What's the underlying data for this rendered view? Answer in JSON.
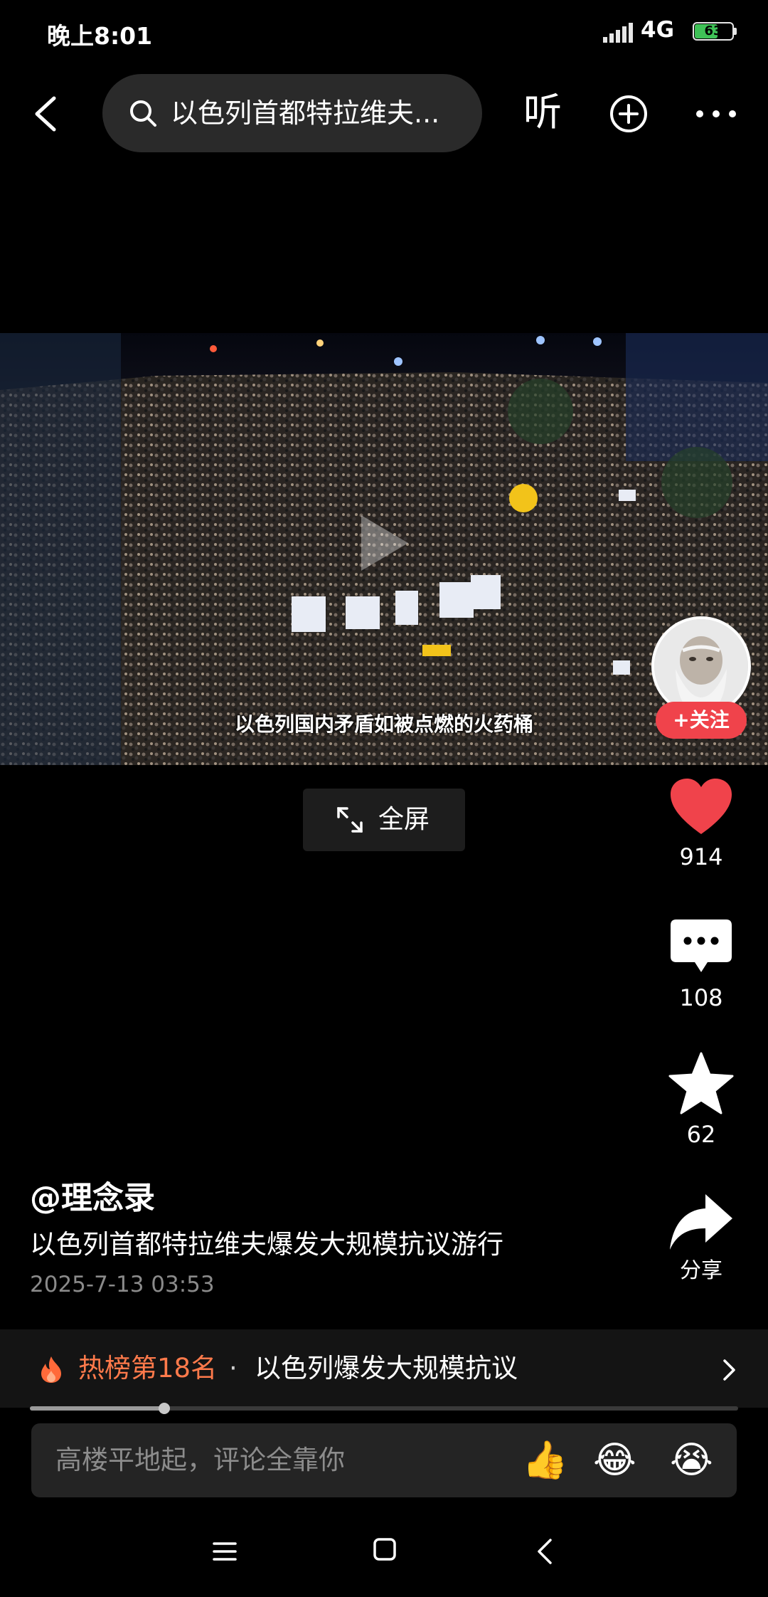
{
  "status_bar": {
    "time": "晚上8:01",
    "network": "4G",
    "battery": "63",
    "battery_level": 0.63
  },
  "top_nav": {
    "search_text": "以色列首都特拉维夫...",
    "listen_label": "听"
  },
  "video": {
    "subtitle": "以色列国内矛盾如被点燃的火药桶"
  },
  "fullscreen_label": "全屏",
  "side_actions": {
    "follow_label": "+关注",
    "like_count": "914",
    "comment_count": "108",
    "favorite_count": "62",
    "share_label": "分享",
    "like_color": "#f0434b"
  },
  "post": {
    "author": "@理念录",
    "caption": "以色列首都特拉维夫爆发大规模抗议游行",
    "timestamp": "2025-7-13 03:53"
  },
  "hot_list": {
    "rank_label": "热榜第18名",
    "separator": "·",
    "topic": "以色列爆发大规模抗议"
  },
  "playback": {
    "progress_fraction": 0.19
  },
  "comment_bar": {
    "placeholder": "高楼平地起，评论全靠你",
    "emojis": [
      "👍",
      "😂",
      "😭"
    ]
  }
}
